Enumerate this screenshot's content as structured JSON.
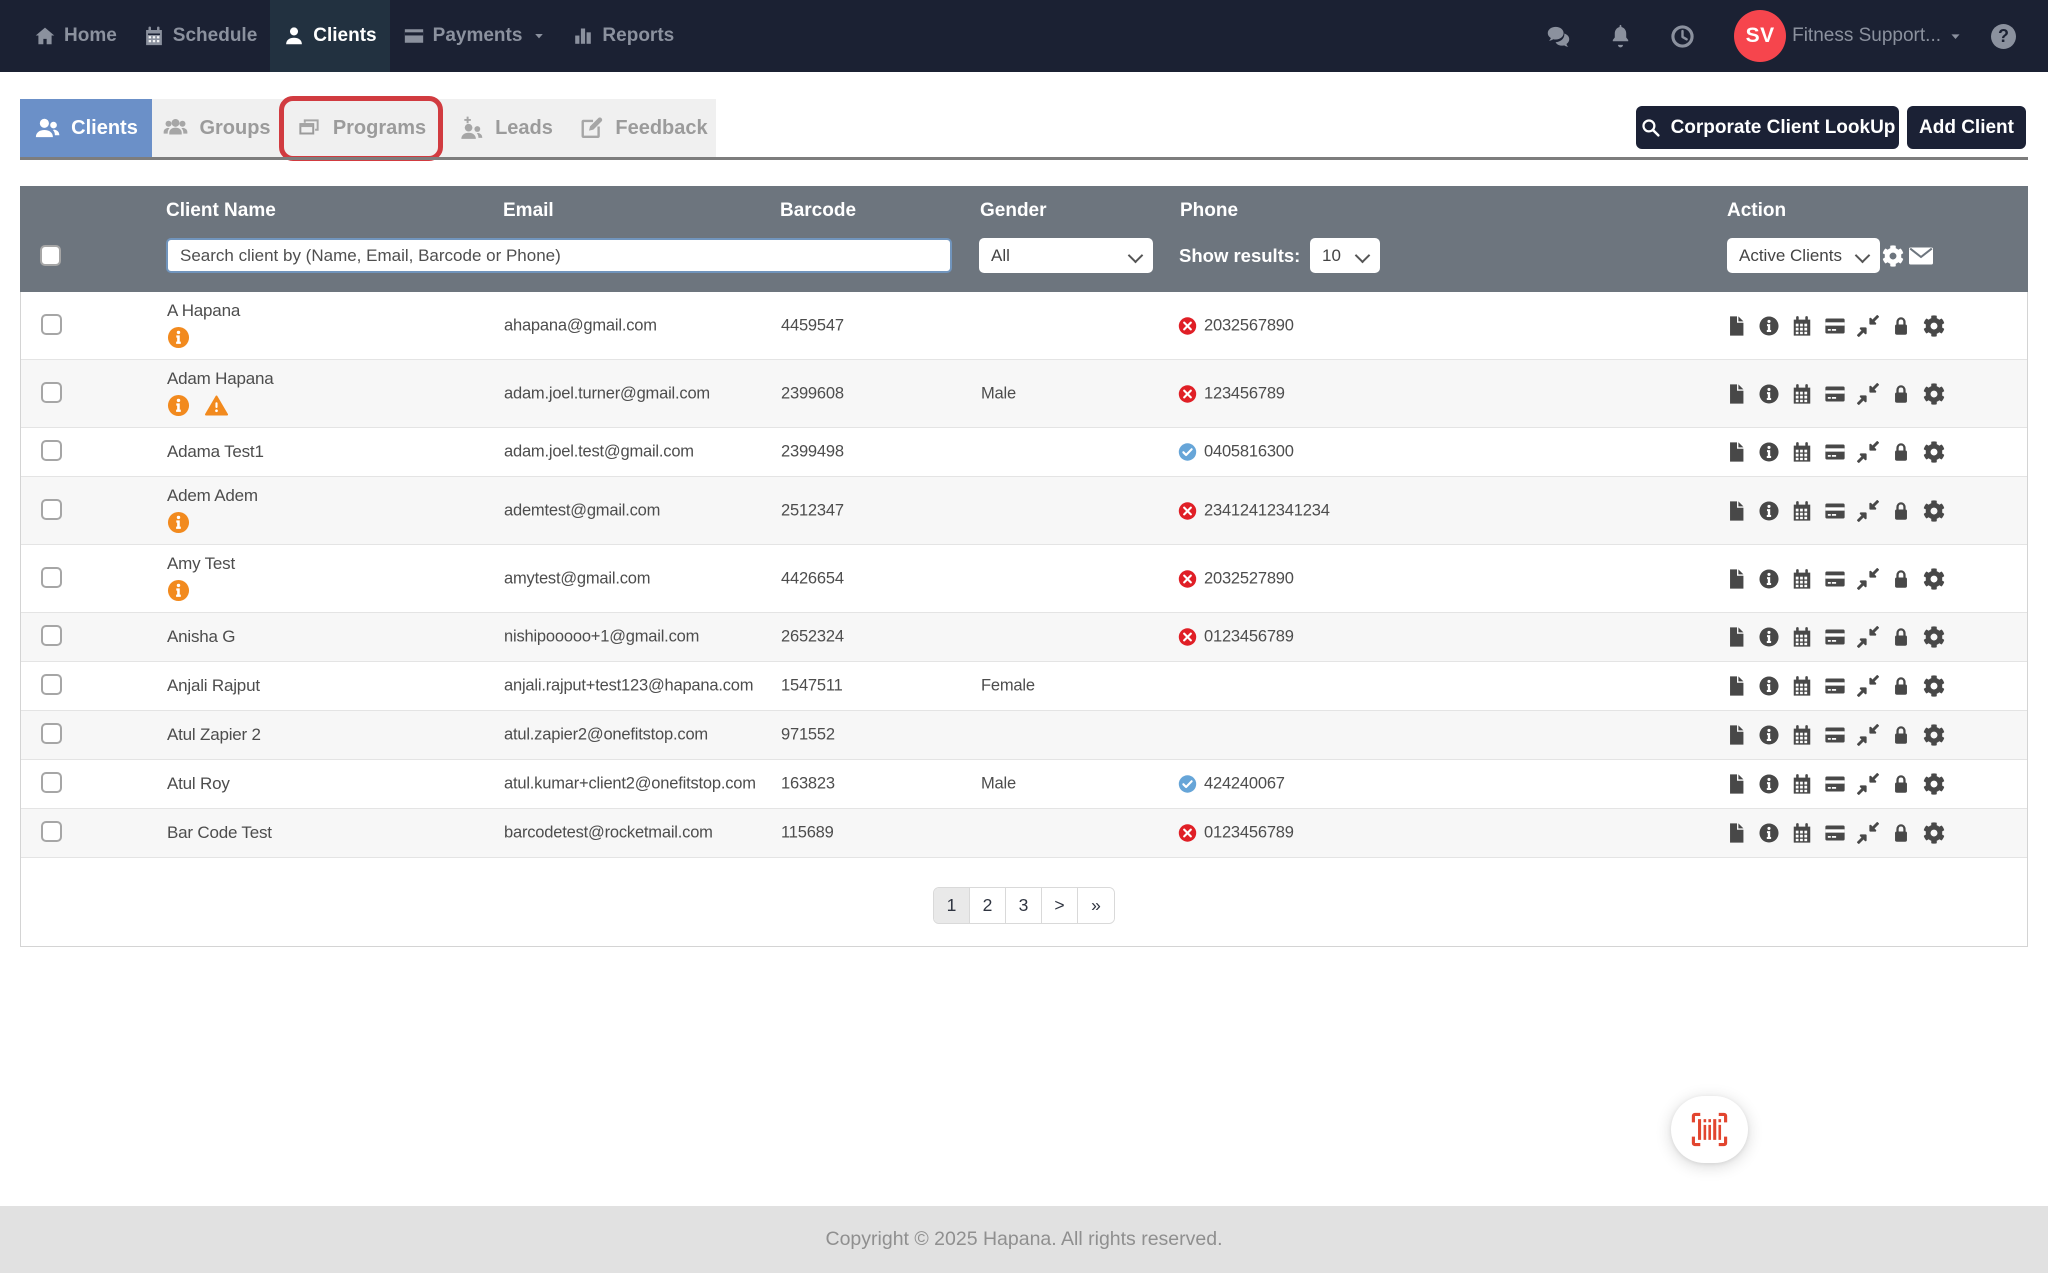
{
  "navbar": {
    "items": [
      {
        "label": "Home",
        "icon": "home"
      },
      {
        "label": "Schedule",
        "icon": "calendar"
      },
      {
        "label": "Clients",
        "icon": "user",
        "active": true
      },
      {
        "label": "Payments",
        "icon": "credit-card",
        "has_caret": true
      },
      {
        "label": "Reports",
        "icon": "bar-chart"
      }
    ],
    "right_icons": [
      "comments",
      "bell",
      "clock"
    ],
    "user": {
      "initials": "SV",
      "name": "Fitness Support...",
      "avatar_color": "#f6454d"
    },
    "help_glyph": "?"
  },
  "tabs": {
    "items": [
      {
        "label": "Clients",
        "icon": "users",
        "active": true
      },
      {
        "label": "Groups",
        "icon": "group"
      },
      {
        "label": "Programs",
        "icon": "programs",
        "annotated": true
      },
      {
        "label": "Leads",
        "icon": "leads"
      },
      {
        "label": "Feedback",
        "icon": "feedback"
      }
    ],
    "annotation_color": "#d13b40"
  },
  "actions": {
    "corporate_lookup": "Corporate Client LookUp",
    "add_client": "Add Client"
  },
  "table": {
    "columns": [
      "Client Name",
      "Email",
      "Barcode",
      "Gender",
      "Phone",
      "Action"
    ],
    "filters": {
      "search_placeholder": "Search client by (Name, Email, Barcode or Phone)",
      "gender_value": "All",
      "show_results_label": "Show results:",
      "show_results_value": "10",
      "action_filter_value": "Active Clients"
    },
    "action_icons": [
      "file",
      "info",
      "calendar",
      "credit-card",
      "compress",
      "lock",
      "gear"
    ],
    "rows": [
      {
        "name": "A Hapana",
        "badges": [
          "info"
        ],
        "email": "ahapana@gmail.com",
        "barcode": "4459547",
        "gender": "",
        "phone": {
          "status": "invalid",
          "number": "2032567890"
        }
      },
      {
        "name": "Adam Hapana",
        "badges": [
          "info",
          "warning"
        ],
        "email": "adam.joel.turner@gmail.com",
        "barcode": "2399608",
        "gender": "Male",
        "phone": {
          "status": "invalid",
          "number": "123456789"
        }
      },
      {
        "name": "Adama Test1",
        "badges": [],
        "email": "adam.joel.test@gmail.com",
        "barcode": "2399498",
        "gender": "",
        "phone": {
          "status": "valid",
          "number": "0405816300"
        }
      },
      {
        "name": "Adem Adem",
        "badges": [
          "info"
        ],
        "email": "ademtest@gmail.com",
        "barcode": "2512347",
        "gender": "",
        "phone": {
          "status": "invalid",
          "number": "23412412341234"
        }
      },
      {
        "name": "Amy Test",
        "badges": [
          "info"
        ],
        "email": "amytest@gmail.com",
        "barcode": "4426654",
        "gender": "",
        "phone": {
          "status": "invalid",
          "number": "2032527890"
        }
      },
      {
        "name": "Anisha G",
        "badges": [],
        "email": "nishipooooo+1@gmail.com",
        "barcode": "2652324",
        "gender": "",
        "phone": {
          "status": "invalid",
          "number": "0123456789"
        }
      },
      {
        "name": "Anjali Rajput",
        "badges": [],
        "email": "anjali.rajput+test123@hapana.com",
        "barcode": "1547511",
        "gender": "Female",
        "phone": null
      },
      {
        "name": "Atul Zapier 2",
        "badges": [],
        "email": "atul.zapier2@onefitstop.com",
        "barcode": "971552",
        "gender": "",
        "phone": null
      },
      {
        "name": "Atul Roy",
        "badges": [],
        "email": "atul.kumar+client2@onefitstop.com",
        "barcode": "163823",
        "gender": "Male",
        "phone": {
          "status": "valid",
          "number": "424240067"
        }
      },
      {
        "name": "Bar Code Test",
        "badges": [],
        "email": "barcodetest@rocketmail.com",
        "barcode": "115689",
        "gender": "",
        "phone": {
          "status": "invalid",
          "number": "0123456789"
        }
      }
    ]
  },
  "pagination": {
    "pages": [
      "1",
      "2",
      "3",
      ">",
      "»"
    ],
    "active": "1"
  },
  "footer": {
    "copyright": "Copyright © 2025 Hapana. All rights reserved."
  },
  "fab": {
    "icon": "barcode-scan",
    "color": "#e2452f"
  },
  "colors": {
    "navbar": "#1b2133",
    "navbar_active": "#223140",
    "tab_active": "#6b90c8",
    "header_band": "#6d757e",
    "badge_orange": "#f28a1e",
    "phone_invalid": "#e01f26",
    "phone_valid": "#66a5d8",
    "annotation_red": "#d13b40",
    "avatar_red": "#f6454d",
    "fab_red": "#e2452f",
    "button_dark": "#1b2135"
  }
}
